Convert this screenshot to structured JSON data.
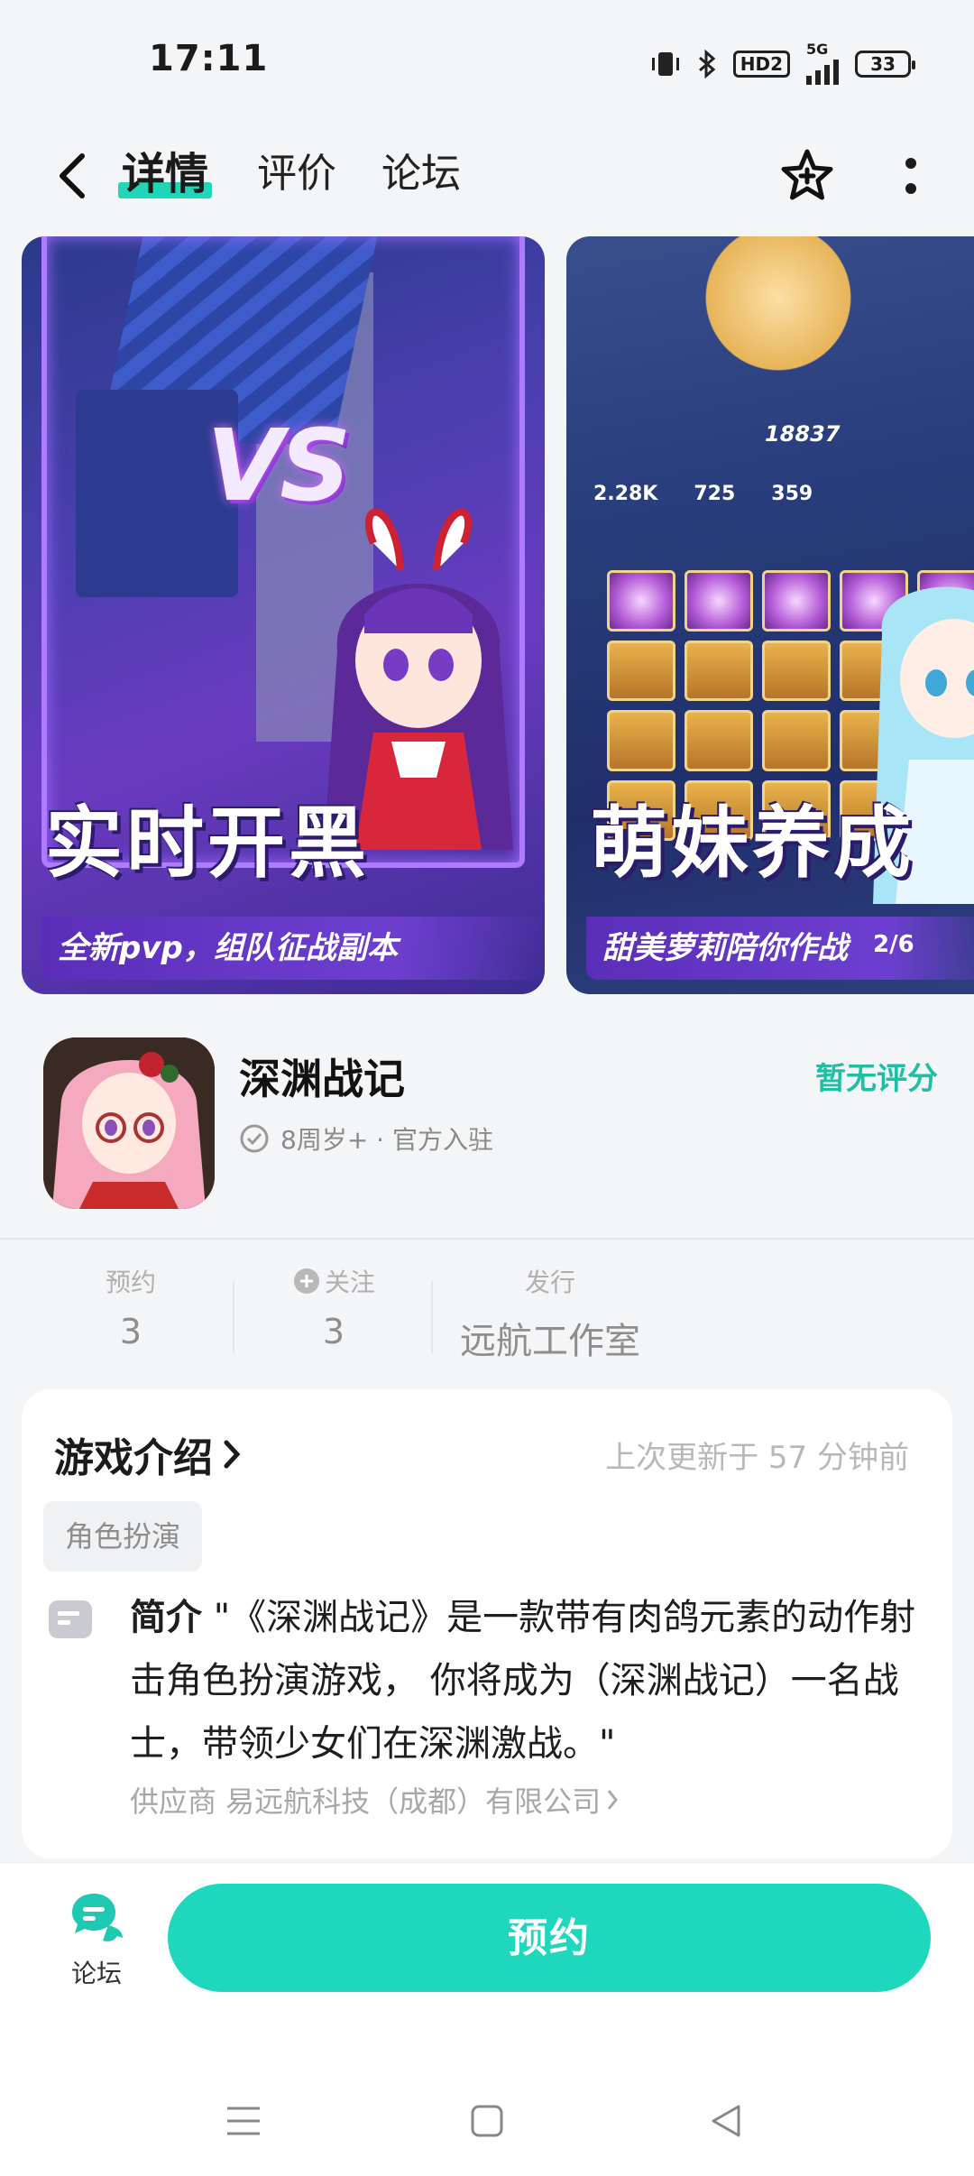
{
  "status_bar": {
    "time": "17:11",
    "hd_label": "HD2",
    "network": "5G",
    "battery": "33"
  },
  "nav": {
    "tabs": [
      {
        "label": "详情",
        "active": true
      },
      {
        "label": "评价",
        "active": false
      },
      {
        "label": "论坛",
        "active": false
      }
    ],
    "accent_color": "#21d6b8"
  },
  "screenshots": [
    {
      "vs_text": "VS",
      "headline": "实时开黑",
      "caption": "全新pvp，组队征战副本"
    },
    {
      "headline": "萌妹养成",
      "caption": "甜美萝莉陪你作战",
      "power": "18837",
      "stats": [
        "2.28K",
        "725",
        "359"
      ],
      "pager": "2/6"
    }
  ],
  "app": {
    "name": "深渊战记",
    "rating_text": "暂无评分",
    "meta": "8周岁+ · 官方入驻"
  },
  "stats": {
    "reserve_label": "预约",
    "reserve_value": "3",
    "follow_label": "关注",
    "follow_value": "3",
    "publisher_label": "发行",
    "publisher_value": "远航工作室"
  },
  "intro": {
    "title": "游戏介绍",
    "updated": "上次更新于 57 分钟前",
    "tag": "角色扮演",
    "summary_label": "简介",
    "summary_text": "\"《深渊战记》是一款带有肉鸽元素的动作射击角色扮演游戏， 你将成为（深渊战记）一名战士，带领少女们在深渊激战。\"",
    "supplier": "供应商 易远航科技（成都）有限公司"
  },
  "bottom_bar": {
    "forum_label": "论坛",
    "reserve_button": "预约",
    "button_color": "#1fd7bd"
  }
}
